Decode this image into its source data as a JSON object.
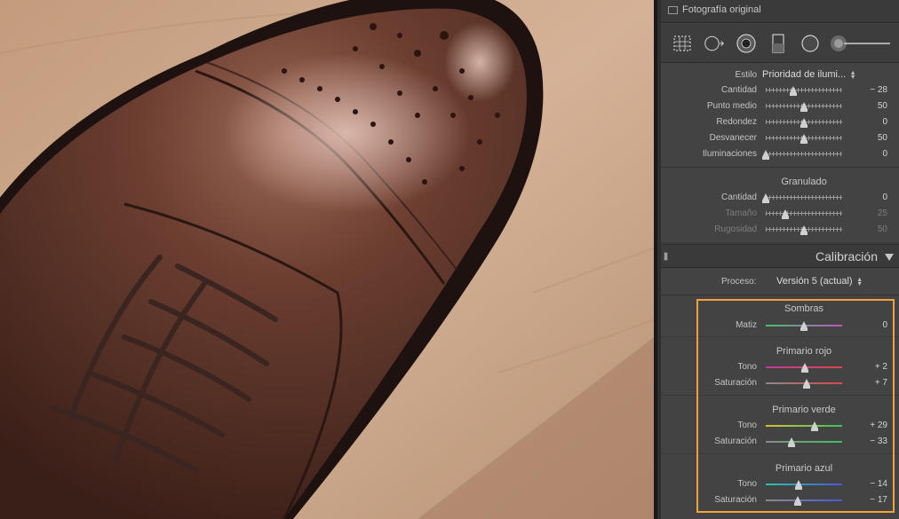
{
  "panel": {
    "original_photo_label": "Fotografía original",
    "vignette": {
      "style_label": "Estilo",
      "style_value": "Prioridad de ilumi...",
      "rows": [
        {
          "label": "Cantidad",
          "value": "− 28",
          "pos": -28,
          "min": -100,
          "max": 100
        },
        {
          "label": "Punto medio",
          "value": "50",
          "pos": 50,
          "min": 0,
          "max": 100
        },
        {
          "label": "Redondez",
          "value": "0",
          "pos": 0,
          "min": -100,
          "max": 100
        },
        {
          "label": "Desvanecer",
          "value": "50",
          "pos": 50,
          "min": 0,
          "max": 100
        },
        {
          "label": "Iluminaciones",
          "value": "0",
          "pos": 0,
          "min": 0,
          "max": 100
        }
      ]
    },
    "grain": {
      "title": "Granulado",
      "rows": [
        {
          "label": "Cantidad",
          "value": "0",
          "pos": 0,
          "min": 0,
          "max": 100
        },
        {
          "label": "Tamaño",
          "value": "25",
          "pos": 25,
          "min": 0,
          "max": 100
        },
        {
          "label": "Rugosidad",
          "value": "50",
          "pos": 50,
          "min": 0,
          "max": 100
        }
      ]
    },
    "calibration": {
      "title": "Calibración",
      "process_label": "Proceso:",
      "process_value": "Versión 5 (actual)",
      "shadows": {
        "title": "Sombras",
        "rows": [
          {
            "label": "Matiz",
            "value": "0",
            "pos": 0,
            "min": -100,
            "max": 100
          }
        ]
      },
      "red": {
        "title": "Primario rojo",
        "rows": [
          {
            "label": "Tono",
            "value": "+ 2",
            "pos": 2,
            "min": -100,
            "max": 100
          },
          {
            "label": "Saturación",
            "value": "+ 7",
            "pos": 7,
            "min": -100,
            "max": 100
          }
        ]
      },
      "green": {
        "title": "Primario verde",
        "rows": [
          {
            "label": "Tono",
            "value": "+ 29",
            "pos": 29,
            "min": -100,
            "max": 100
          },
          {
            "label": "Saturación",
            "value": "− 33",
            "pos": -33,
            "min": -100,
            "max": 100
          }
        ]
      },
      "blue": {
        "title": "Primario azul",
        "rows": [
          {
            "label": "Tono",
            "value": "− 14",
            "pos": -14,
            "min": -100,
            "max": 100
          },
          {
            "label": "Saturación",
            "value": "− 17",
            "pos": -17,
            "min": -100,
            "max": 100
          }
        ]
      }
    },
    "tool_icons": [
      "crop-overlay-icon",
      "spot-removal-icon",
      "red-eye-icon",
      "graduated-filter-icon",
      "radial-filter-icon",
      "adjustment-brush-icon"
    ],
    "highlight_color": "#f3a13a"
  }
}
